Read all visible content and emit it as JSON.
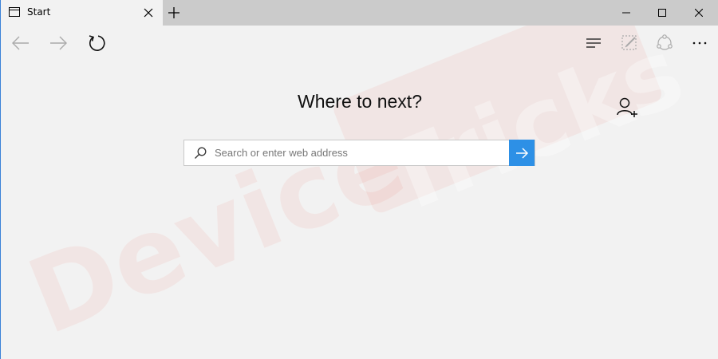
{
  "tab": {
    "title": "Start",
    "icon": "page-icon"
  },
  "toolbar": {
    "back_icon": "arrow-left-icon",
    "forward_icon": "arrow-right-icon",
    "refresh_icon": "refresh-icon",
    "hub_icon": "hub-icon",
    "notes_icon": "web-note-icon",
    "share_icon": "share-icon",
    "more_icon": "more-icon"
  },
  "main": {
    "heading": "Where to next?",
    "search": {
      "placeholder": "Search or enter web address",
      "value": ""
    },
    "add_user_icon": "add-user-icon"
  },
  "watermark": {
    "left": "Device",
    "right": "Tricks"
  },
  "colors": {
    "accent": "#2d90e6",
    "tab_strip": "#cbcbcb",
    "page_bg": "#f2f2f2",
    "watermark": "#e8503a"
  }
}
